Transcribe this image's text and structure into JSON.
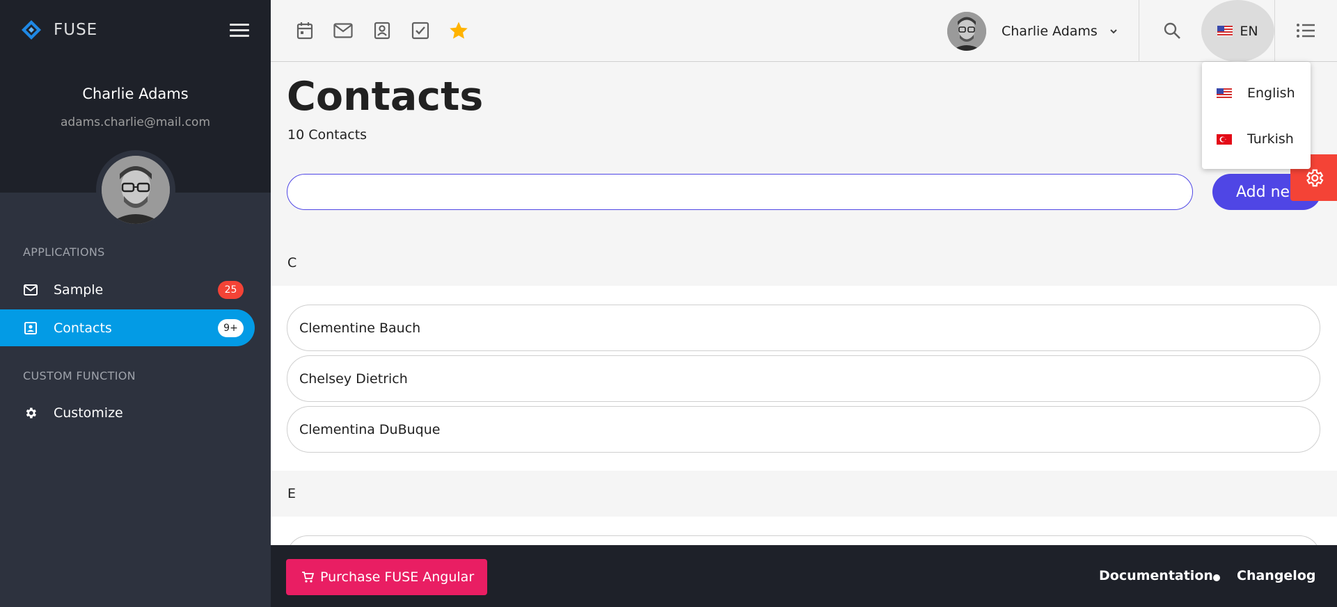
{
  "brand": {
    "name": "FUSE"
  },
  "user": {
    "name": "Charlie Adams",
    "email": "adams.charlie@mail.com"
  },
  "nav": {
    "applications_heading": "APPLICATIONS",
    "custom_heading": "CUSTOM FUNCTION",
    "items": [
      {
        "label": "Sample",
        "badge": "25",
        "icon": "mail-icon"
      },
      {
        "label": "Contacts",
        "badge": "9+",
        "icon": "contacts-icon",
        "active": true
      },
      {
        "label": "Customize",
        "icon": "gear-icon"
      }
    ]
  },
  "toolbar": {
    "shortcuts": [
      "calendar-icon",
      "mail-icon",
      "contacts-icon",
      "task-check-icon",
      "star-icon"
    ],
    "user_name": "Charlie Adams",
    "language_code": "EN"
  },
  "language_menu": {
    "options": [
      {
        "label": "English",
        "flag": "us-flag-icon"
      },
      {
        "label": "Turkish",
        "flag": "tr-flag-icon"
      }
    ]
  },
  "page": {
    "title": "Contacts",
    "subtitle": "10 Contacts",
    "search_value": "",
    "add_button": "Add new"
  },
  "groups": [
    {
      "letter": "C",
      "contacts": [
        "Clementine Bauch",
        "Chelsey Dietrich",
        "Clementina DuBuque"
      ]
    },
    {
      "letter": "E",
      "contacts": []
    }
  ],
  "footer": {
    "purchase": "Purchase FUSE Angular",
    "documentation": "Documentation",
    "changelog": "Changelog"
  },
  "colors": {
    "accent": "#4f46e5",
    "nav_active": "#039be5",
    "badge_red": "#f44336",
    "purchase": "#e91e63",
    "sidebar": "#2d323e",
    "sidebar_dark": "#1e2129"
  }
}
